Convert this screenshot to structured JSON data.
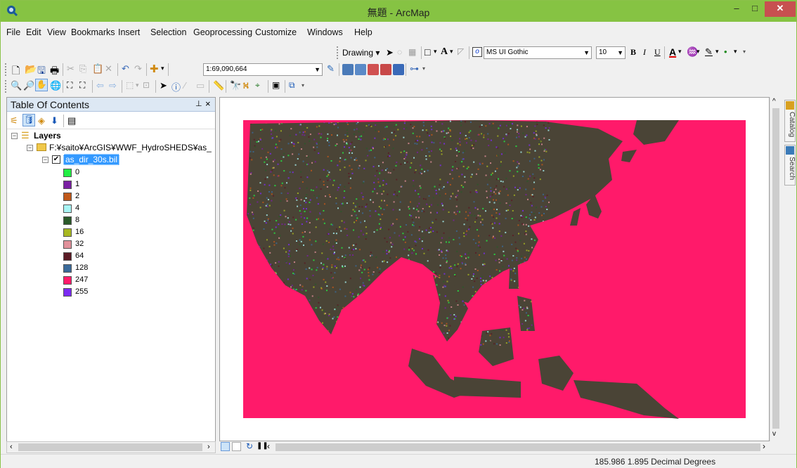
{
  "window": {
    "title": "無題 - ArcMap",
    "min": "‒",
    "max": "□",
    "close": "✕"
  },
  "menu": [
    "File",
    "Edit",
    "View",
    "Bookmarks",
    "Insert",
    "Selection",
    "Geoprocessing",
    "Customize",
    "Windows",
    "Help"
  ],
  "drawing_toolbar": {
    "drawing_label": "Drawing ▾",
    "font_name": "MS UI Gothic",
    "font_size": "10",
    "bold": "B",
    "italic": "I",
    "underline": "U",
    "font_color_letter": "A"
  },
  "standard_toolbar": {
    "scale_value": "1:69,090,664"
  },
  "toc": {
    "title": "Table Of Contents",
    "pin": "📌",
    "close": "×",
    "layers_label": "Layers",
    "group_path": "F:¥saito¥ArcGIS¥WWF_HydroSHEDS¥as_",
    "layer_name": "as_dir_30s.bil",
    "legend": [
      {
        "value": "0",
        "color": "#22ee44"
      },
      {
        "value": "1",
        "color": "#7a1fa2"
      },
      {
        "value": "2",
        "color": "#c0581a"
      },
      {
        "value": "4",
        "color": "#a8f4f4"
      },
      {
        "value": "8",
        "color": "#2a5a2a"
      },
      {
        "value": "16",
        "color": "#a8b820"
      },
      {
        "value": "32",
        "color": "#e0909a"
      },
      {
        "value": "64",
        "color": "#5a1a24"
      },
      {
        "value": "128",
        "color": "#3a6a9a"
      },
      {
        "value": "247",
        "color": "#ff1a6a"
      },
      {
        "value": "255",
        "color": "#7a2af2"
      }
    ]
  },
  "side_tabs": {
    "catalog": "Catalog",
    "search": "Search"
  },
  "status": {
    "coords": "185.986  1.895 Decimal Degrees"
  },
  "colors": {
    "title_bar": "#86c343",
    "map_background": "#ff1a6a",
    "selection": "#3399ff"
  }
}
